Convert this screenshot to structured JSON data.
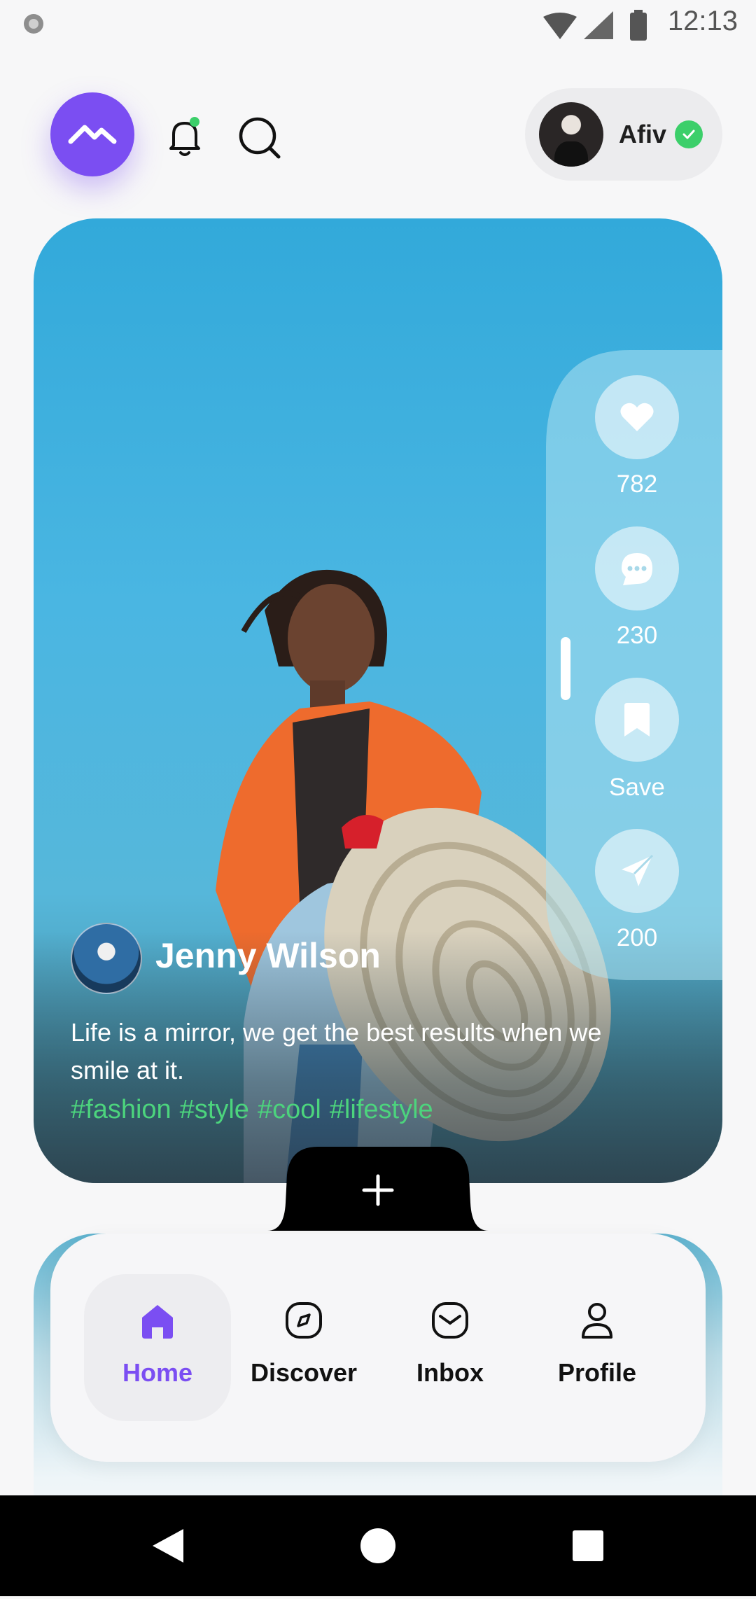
{
  "status_bar": {
    "time": "12:13"
  },
  "header": {
    "user": {
      "name": "Afiv",
      "verified": true
    }
  },
  "post": {
    "author": "Jenny Wilson",
    "caption": "Life is a mirror, we get the best results when we smile at it.",
    "hashtags": [
      "#fashion",
      "#style",
      "#cool",
      "#lifestyle"
    ],
    "actions": [
      {
        "name": "like",
        "label": "782",
        "icon": "heart-icon"
      },
      {
        "name": "comment",
        "label": "230",
        "icon": "comment-icon"
      },
      {
        "name": "save",
        "label": "Save",
        "icon": "bookmark-icon"
      },
      {
        "name": "share",
        "label": "200",
        "icon": "send-icon"
      }
    ]
  },
  "bottom_nav": {
    "items": [
      {
        "label": "Home",
        "icon": "home-icon",
        "active": true
      },
      {
        "label": "Discover",
        "icon": "compass-icon",
        "active": false
      },
      {
        "label": "Inbox",
        "icon": "inbox-icon",
        "active": false
      },
      {
        "label": "Profile",
        "icon": "user-icon",
        "active": false
      }
    ]
  },
  "colors": {
    "accent": "#7b4ef2",
    "hashtag": "#4cd47d",
    "verified": "#3ccf6a",
    "sky": "#3aaedd"
  }
}
